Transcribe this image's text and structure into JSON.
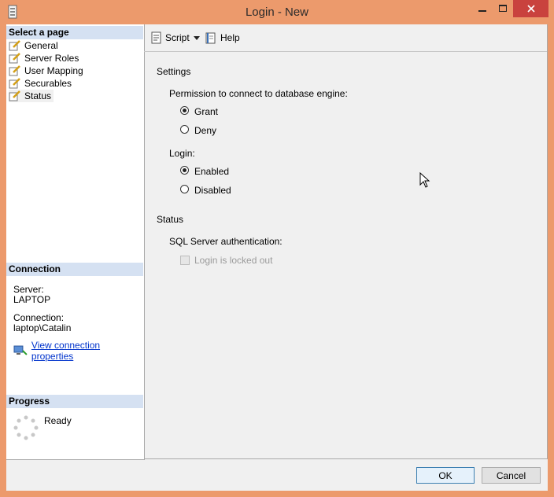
{
  "window": {
    "title": "Login - New"
  },
  "left": {
    "select_page_header": "Select a page",
    "pages": [
      {
        "label": "General",
        "icon": "page-icon"
      },
      {
        "label": "Server Roles",
        "icon": "page-icon"
      },
      {
        "label": "User Mapping",
        "icon": "page-icon"
      },
      {
        "label": "Securables",
        "icon": "page-icon"
      },
      {
        "label": "Status",
        "icon": "page-icon",
        "selected": true
      }
    ],
    "connection_header": "Connection",
    "server_label": "Server:",
    "server_value": "LAPTOP",
    "connection_label": "Connection:",
    "connection_value": "laptop\\Catalin",
    "view_props_link": "View connection properties",
    "progress_header": "Progress",
    "progress_status": "Ready"
  },
  "toolbar": {
    "script_label": "Script",
    "help_label": "Help"
  },
  "content": {
    "settings_header": "Settings",
    "permission_label": "Permission to connect to database engine:",
    "grant_label": "Grant",
    "deny_label": "Deny",
    "login_label": "Login:",
    "enabled_label": "Enabled",
    "disabled_label": "Disabled",
    "status_header": "Status",
    "sql_auth_label": "SQL Server authentication:",
    "locked_out_label": "Login is locked out"
  },
  "footer": {
    "ok_label": "OK",
    "cancel_label": "Cancel"
  }
}
